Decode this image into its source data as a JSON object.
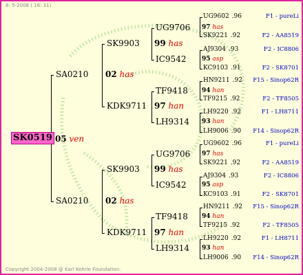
{
  "header_date": "8- 5-2008 ( 16: 31)",
  "copyright": "Copyright 2004-2008 @ Karl Kehrle Foundation.",
  "root": {
    "label": "SK0519",
    "gen_num": "05",
    "gen_tag": "ven"
  },
  "gen1": [
    {
      "label": "SA0210",
      "gen_num": "02",
      "gen_tag": "has"
    },
    {
      "label": "SA0210",
      "gen_num": "02",
      "gen_tag": "has"
    }
  ],
  "gen2": [
    {
      "label": "SK9903",
      "gen_num": "99",
      "gen_tag": "has"
    },
    {
      "label": "KDK9711",
      "gen_num": "97",
      "gen_tag": "han"
    },
    {
      "label": "SK9903",
      "gen_num": "99",
      "gen_tag": "has"
    },
    {
      "label": "KDK9711",
      "gen_num": "97",
      "gen_tag": "han"
    }
  ],
  "gen3": [
    {
      "label": "UG9706",
      "gen_num": "97",
      "gen_tag": "has"
    },
    {
      "label": "IC9542",
      "gen_num": "95",
      "gen_tag": "asp"
    },
    {
      "label": "TF9418",
      "gen_num": "94",
      "gen_tag": "han"
    },
    {
      "label": "LH9314",
      "gen_num": "93",
      "gen_tag": "han"
    },
    {
      "label": "UG9706",
      "gen_num": "97",
      "gen_tag": "has"
    },
    {
      "label": "IC9542",
      "gen_num": "95",
      "gen_tag": "asp"
    },
    {
      "label": "TF9418",
      "gen_num": "94",
      "gen_tag": "han"
    },
    {
      "label": "LH9314",
      "gen_num": "93",
      "gen_tag": "han"
    }
  ],
  "gen4": [
    {
      "id": "UG9602",
      "yr": ".96",
      "src": "F1 - pureLi"
    },
    {
      "id": "SK9221",
      "yr": ".92",
      "src": "F2 - AA8519"
    },
    {
      "id": "AJ9304",
      "yr": ".93",
      "src": "F2 - IC8806"
    },
    {
      "id": "KC9103",
      "yr": ".91",
      "src": "F2 - SK8701"
    },
    {
      "id": "HN9211",
      "yr": ".92",
      "src": "F15 - Sinop62R"
    },
    {
      "id": "TF9215",
      "yr": ".92",
      "src": "F2 - TF8505"
    },
    {
      "id": "LH9220",
      "yr": ".92",
      "src": "F1 - LH8711"
    },
    {
      "id": "LH9006",
      "yr": ".90",
      "src": "F14 - Sinop62R"
    },
    {
      "id": "UG9602",
      "yr": ".96",
      "src": "F1 - pureLi"
    },
    {
      "id": "SK9221",
      "yr": ".92",
      "src": "F2 - AA8519"
    },
    {
      "id": "AJ9304",
      "yr": ".93",
      "src": "F2 - IC8806"
    },
    {
      "id": "KC9103",
      "yr": ".91",
      "src": "F2 - SK8701"
    },
    {
      "id": "HN9211",
      "yr": ".92",
      "src": "F15 - Sinop62R"
    },
    {
      "id": "TF9215",
      "yr": ".92",
      "src": "F2 - TF8505"
    },
    {
      "id": "LH9220",
      "yr": ".92",
      "src": "F1 - LH8711"
    },
    {
      "id": "LH9006",
      "yr": ".90",
      "src": "F14 - Sinop62R"
    }
  ]
}
